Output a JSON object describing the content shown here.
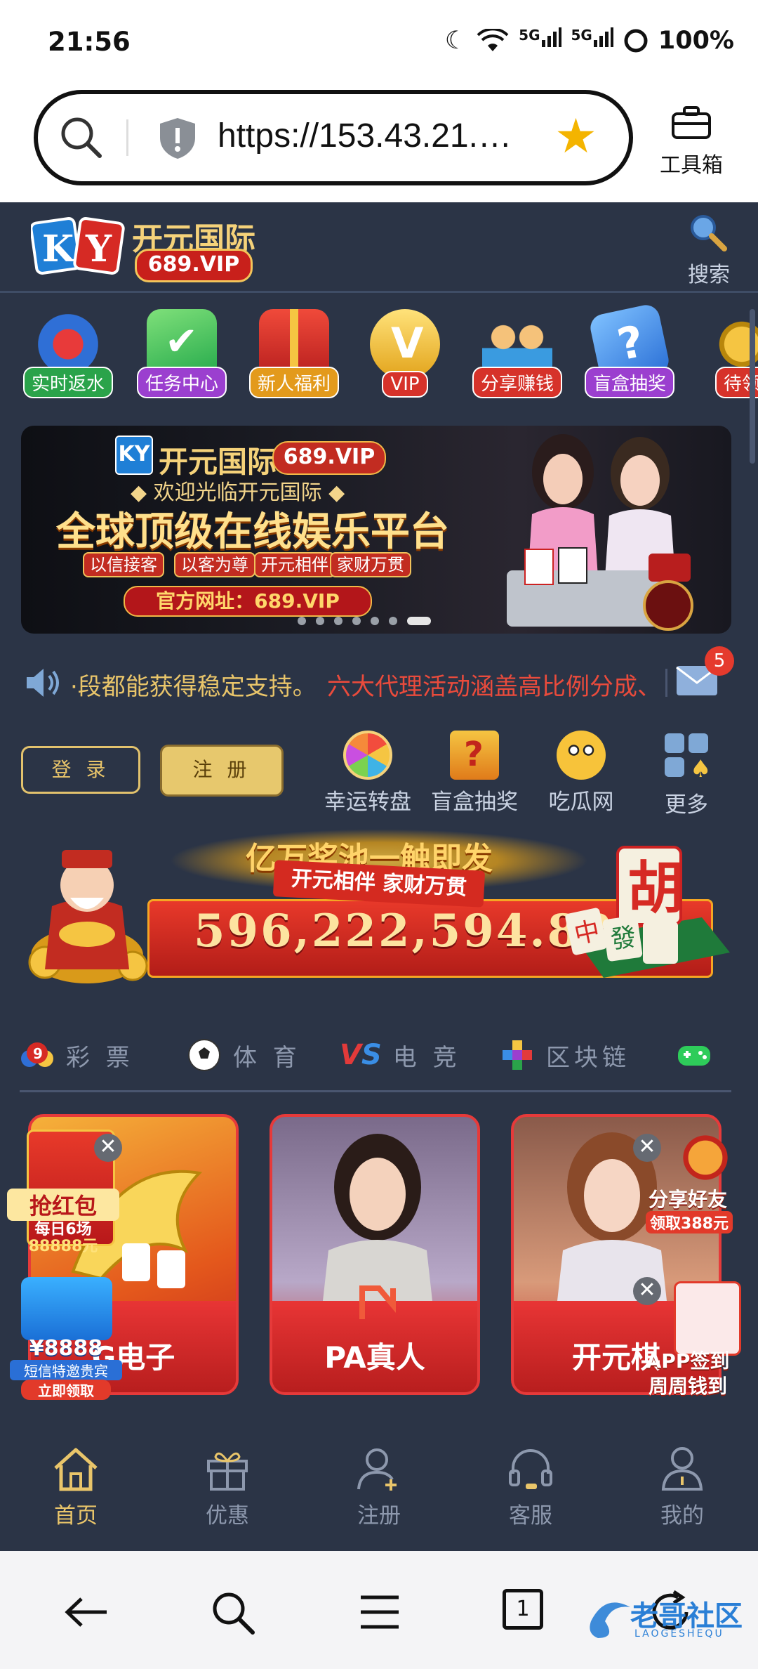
{
  "status_bar": {
    "time": "21:56",
    "net1": "5G",
    "net2": "5G",
    "battery": "100%"
  },
  "browser": {
    "url": "https://153.43.21.…",
    "toolbox_label": "工具箱"
  },
  "header": {
    "brand": "开元国际",
    "brand_vip": "689.VIP",
    "search_label": "搜索"
  },
  "quick_icons": [
    {
      "label": "实时返水",
      "color": "#2aa34a"
    },
    {
      "label": "任务中心",
      "color": "#9b3fcf"
    },
    {
      "label": "新人福利",
      "color": "#e39a1c"
    },
    {
      "label": "VIP",
      "color": "#d6322a"
    },
    {
      "label": "分享赚钱",
      "color": "#d6322a"
    },
    {
      "label": "盲盒抽奖",
      "color": "#9b3fcf"
    },
    {
      "label": "待领",
      "color": "#d6322a"
    }
  ],
  "banner": {
    "brand": "开元国际",
    "vip": "689.VIP",
    "welcome": "◆ 欢迎光临开元国际 ◆",
    "headline": "全球顶级在线娱乐平台",
    "tags": [
      "以信接客",
      "以客为尊",
      "开元相伴",
      "家财万贯"
    ],
    "url": "官方网址：689.VIP"
  },
  "marquee": {
    "text1": "·段都能获得稳定支持。",
    "text2": "六大代理活动涵盖高比例分成、",
    "mail_count": "5"
  },
  "auth": {
    "login": "登 录",
    "register": "注 册"
  },
  "tools": [
    {
      "label": "幸运转盘"
    },
    {
      "label": "盲盒抽奖"
    },
    {
      "label": "吃瓜网"
    },
    {
      "label": "更多"
    }
  ],
  "jackpot": {
    "title": "亿万奖池一触即发",
    "ribbon": "开元相伴 家财万贯",
    "value": "596,222,594.88"
  },
  "categories": [
    {
      "label": "彩 票",
      "icon": "lottery-ball-icon"
    },
    {
      "label": "体 育",
      "icon": "soccer-ball-icon"
    },
    {
      "label": "电 竞",
      "icon": "vs-icon"
    },
    {
      "label": "区块链",
      "icon": "blockchain-cubes-icon"
    },
    {
      "label": "",
      "icon": "gamepad-icon"
    }
  ],
  "games": [
    {
      "label": "G电子"
    },
    {
      "label": "PA真人"
    },
    {
      "label": "开元棋"
    }
  ],
  "floats": {
    "redpacket": {
      "title": "抢红包",
      "line1": "每日6场",
      "line2": "88888元"
    },
    "sms": {
      "amount": "¥8888",
      "line1": "短信特邀贵宾",
      "cta": "立即领取"
    },
    "share": {
      "title": "分享好友",
      "sub": "领取388元"
    },
    "sign": {
      "title": "APP签到",
      "sub": "周周钱到"
    }
  },
  "bottom_nav": [
    {
      "label": "首页"
    },
    {
      "label": "优惠"
    },
    {
      "label": "注册"
    },
    {
      "label": "客服"
    },
    {
      "label": "我的"
    }
  ],
  "system_nav": {
    "tab_count": "1",
    "watermark": "老哥社区",
    "watermark_sub": "LAOGESHEQU"
  }
}
